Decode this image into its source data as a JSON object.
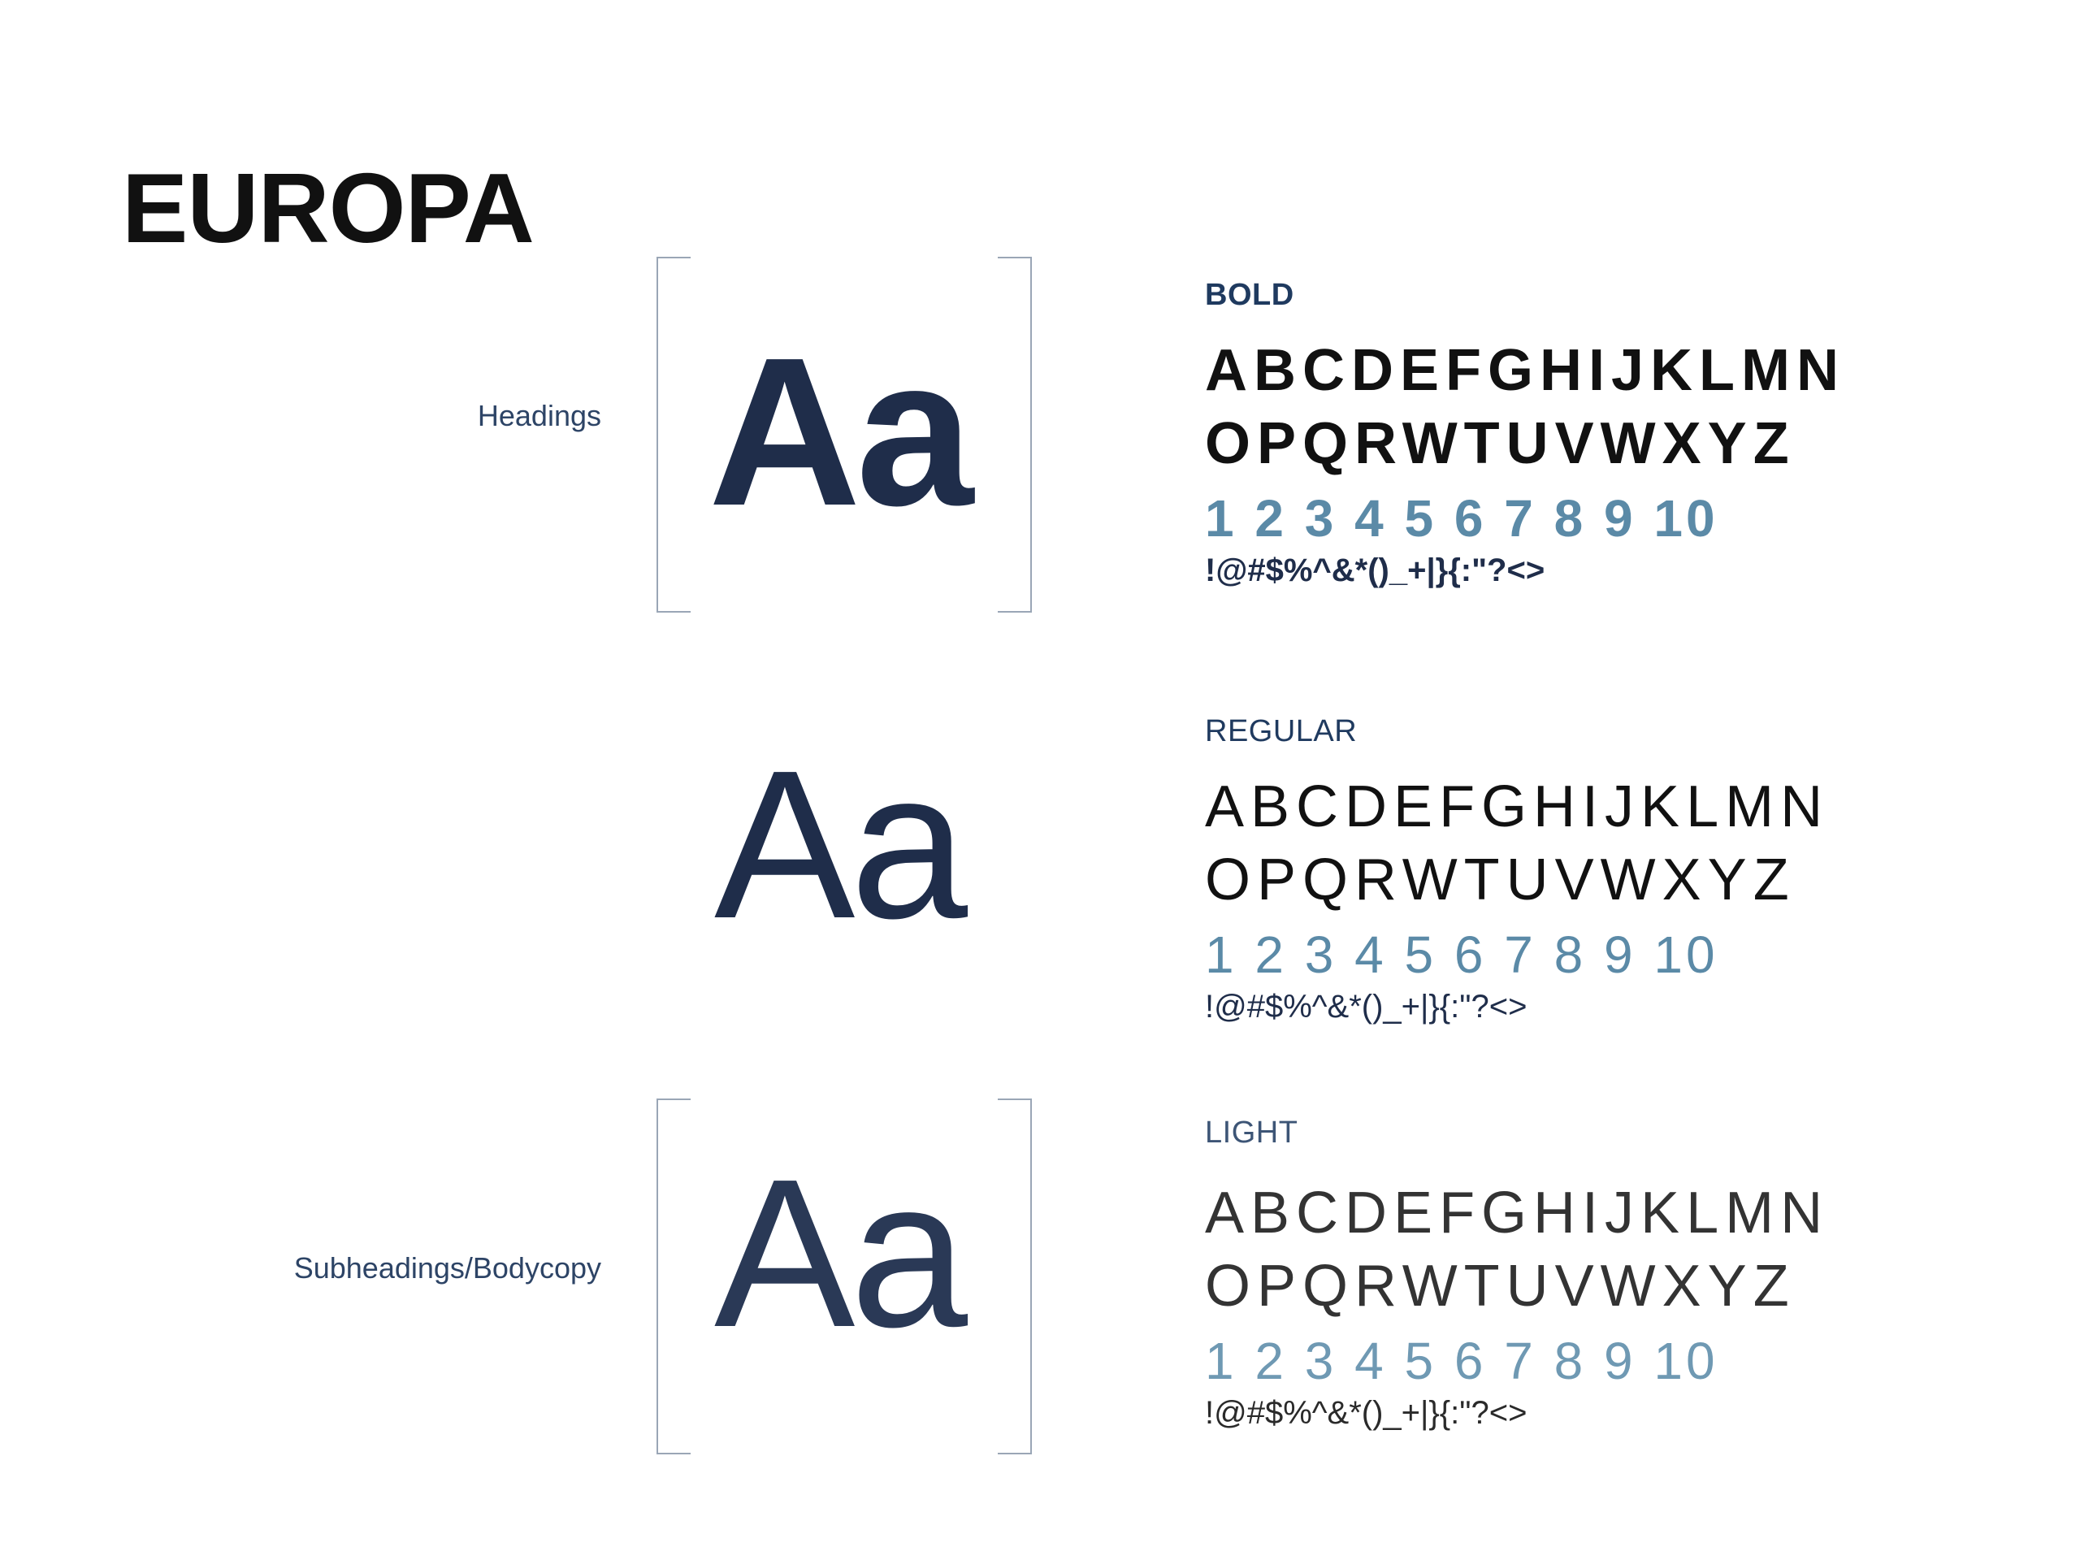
{
  "title": "EUROPA",
  "roles": {
    "headings": "Headings",
    "subheadings": "Subheadings/Bodycopy"
  },
  "sample_glyph": "Aa",
  "weights": [
    {
      "name": "BOLD",
      "row1": "ABCDEFGHIJKLMN",
      "row2": "OPQRWTUVWXYZ",
      "numbers": "1 2 3 4 5 6 7 8 9 10",
      "symbols": "!@#$%^&*()_+|}{:\"?<>"
    },
    {
      "name": "REGULAR",
      "row1": "ABCDEFGHIJKLMN",
      "row2": "OPQRWTUVWXYZ",
      "numbers": "1 2 3 4 5 6 7 8 9 10",
      "symbols": "!@#$%^&*()_+|}{:\"?<>"
    },
    {
      "name": "LIGHT",
      "row1": "ABCDEFGHIJKLMN",
      "row2": "OPQRWTUVWXYZ",
      "numbers": "1 2 3 4 5 6 7 8 9 10",
      "symbols": "!@#$%^&*()_+|}{:\"?<>"
    }
  ],
  "colors": {
    "text_dark": "#111111",
    "navy": "#1f2d4a",
    "number_blue": "#5b8aa7",
    "bracket": "#9aa6b6"
  }
}
